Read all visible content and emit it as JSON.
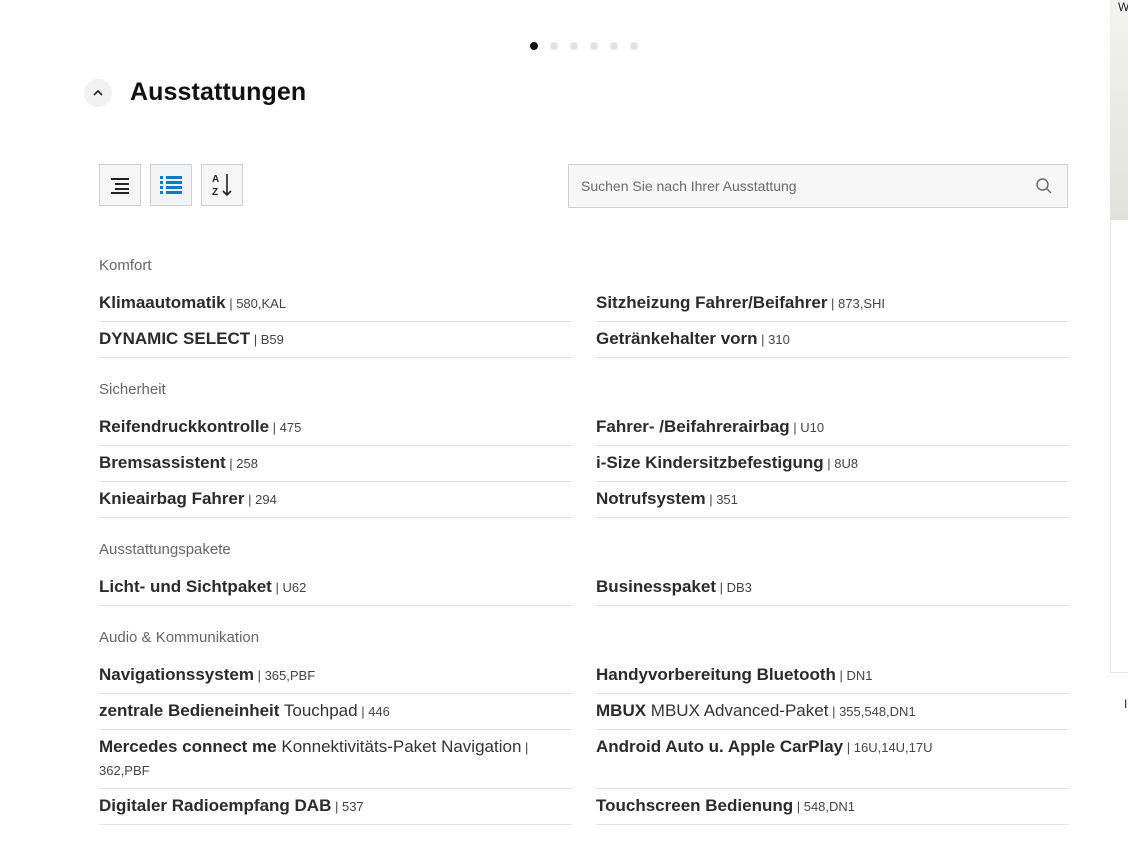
{
  "carousel": {
    "count": 6,
    "active": 0
  },
  "section": {
    "title": "Ausstattungen"
  },
  "toolbar": {
    "buttons": [
      {
        "name": "compact-list-view",
        "icon": "list-indent-icon"
      },
      {
        "name": "detailed-list-view",
        "icon": "list-bullets-icon",
        "active": true
      },
      {
        "name": "sort-alphabetical",
        "icon": "sort-az-icon"
      }
    ]
  },
  "search": {
    "placeholder": "Suchen Sie nach Ihrer Ausstattung",
    "value": ""
  },
  "groups": [
    {
      "title": "Komfort",
      "items": [
        {
          "name": "Klimaautomatik",
          "sub": "",
          "code": "580,KAL"
        },
        {
          "name": "Sitzheizung Fahrer/Beifahrer",
          "sub": "",
          "code": "873,SHI"
        },
        {
          "name": "DYNAMIC SELECT",
          "sub": "",
          "code": "B59"
        },
        {
          "name": "Getränkehalter vorn",
          "sub": "",
          "code": "310"
        }
      ]
    },
    {
      "title": "Sicherheit",
      "items": [
        {
          "name": "Reifendruckkontrolle",
          "sub": "",
          "code": "475"
        },
        {
          "name": "Fahrer- /Beifahrerairbag",
          "sub": "",
          "code": "U10"
        },
        {
          "name": "Bremsassistent",
          "sub": "",
          "code": "258"
        },
        {
          "name": "i-Size Kindersitzbefestigung",
          "sub": "",
          "code": "8U8"
        },
        {
          "name": "Knieairbag Fahrer",
          "sub": "",
          "code": "294"
        },
        {
          "name": "Notrufsystem",
          "sub": "",
          "code": "351"
        }
      ]
    },
    {
      "title": "Ausstattungspakete",
      "items": [
        {
          "name": "Licht- und Sichtpaket",
          "sub": "",
          "code": "U62"
        },
        {
          "name": "Businesspaket",
          "sub": "",
          "code": "DB3"
        }
      ]
    },
    {
      "title": "Audio & Kommunikation",
      "items": [
        {
          "name": "Navigationssystem",
          "sub": "",
          "code": "365,PBF"
        },
        {
          "name": "Handyvorbereitung Bluetooth",
          "sub": "",
          "code": "DN1"
        },
        {
          "name": "zentrale Bedieneinheit",
          "sub": "Touchpad",
          "code": "446"
        },
        {
          "name": "MBUX",
          "sub": "MBUX Advanced-Paket",
          "code": "355,548,DN1"
        },
        {
          "name": "Mercedes connect me",
          "sub": "Konnektivitäts-Paket Navigation",
          "code": "362,PBF"
        },
        {
          "name": "Android Auto u. Apple CarPlay",
          "sub": "",
          "code": "16U,14U,17U"
        },
        {
          "name": "Digitaler Radioempfang DAB",
          "sub": "",
          "code": "537"
        },
        {
          "name": "Touchscreen Bedienung",
          "sub": "",
          "code": "548,DN1"
        }
      ]
    }
  ],
  "edge": {
    "top_text": "W",
    "bottom_text": "I"
  }
}
